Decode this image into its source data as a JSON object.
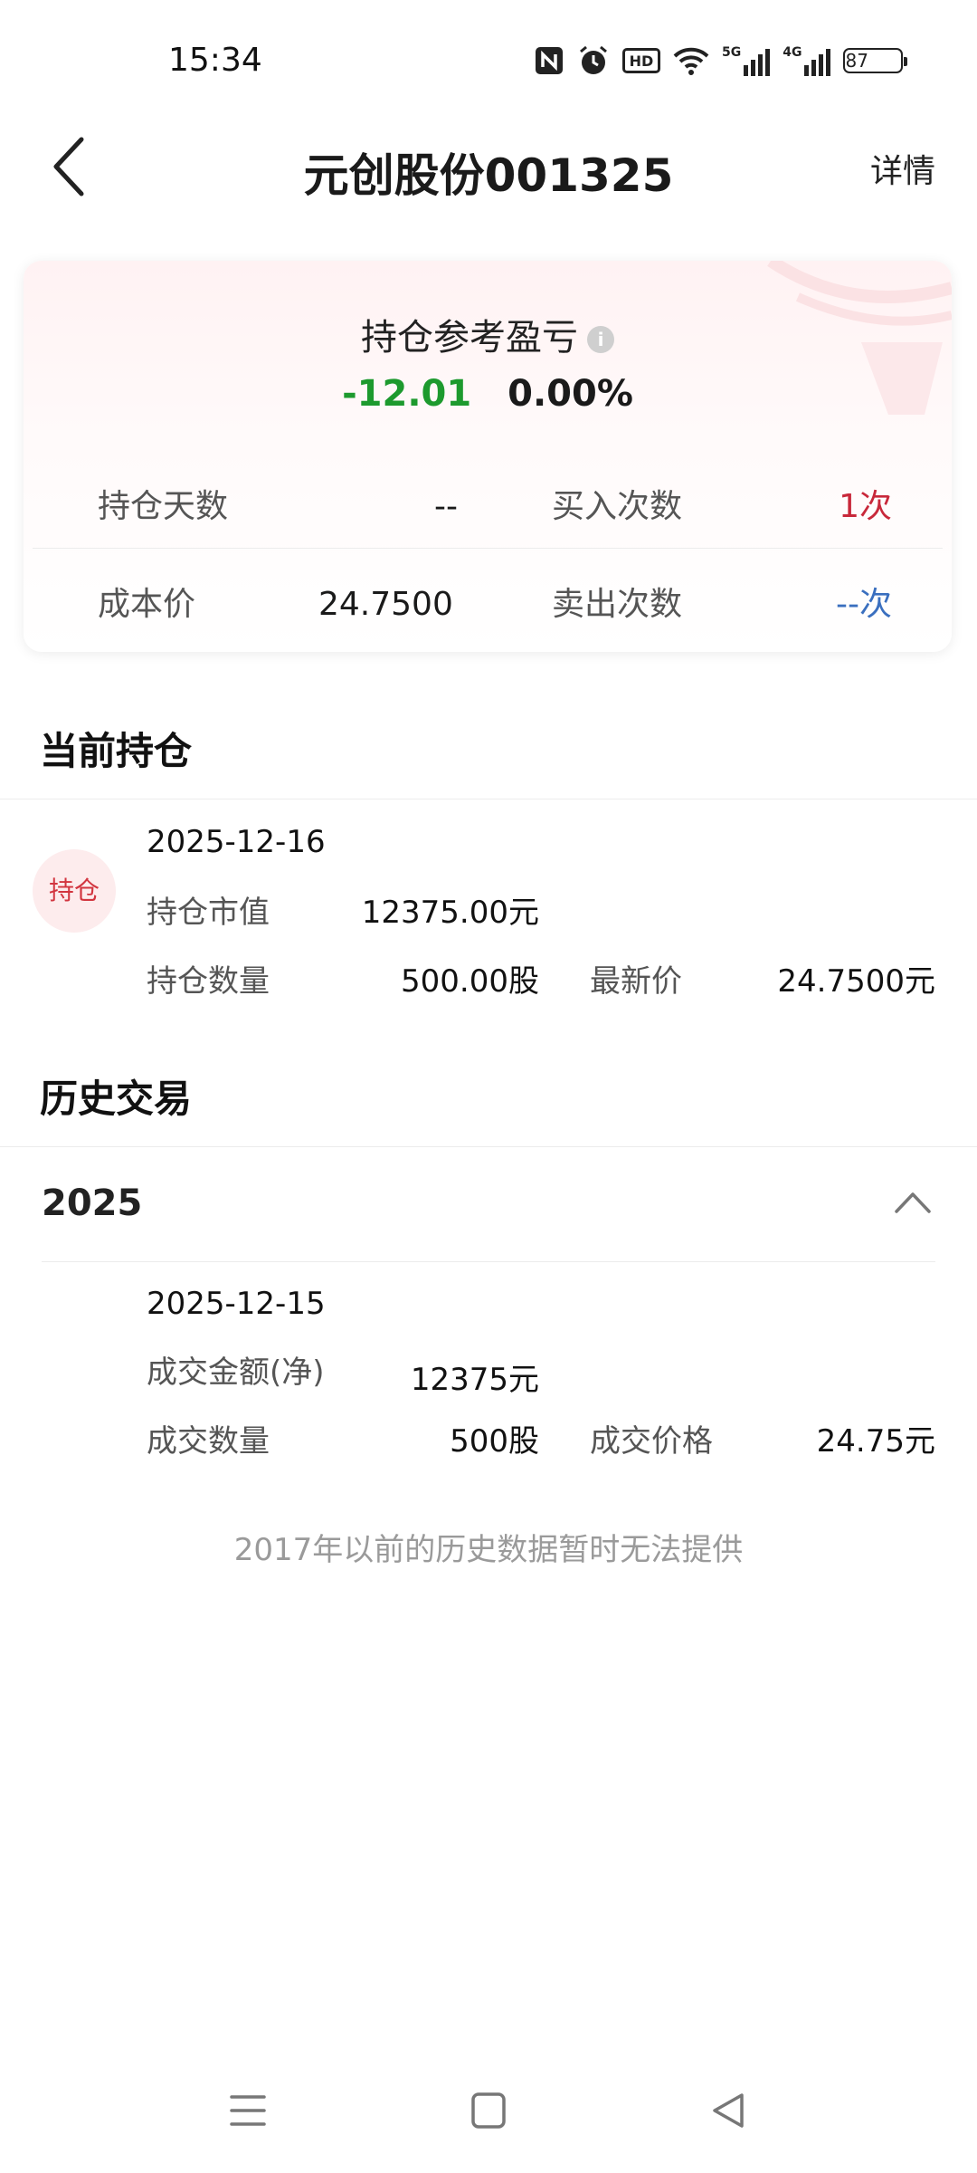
{
  "status_bar": {
    "time": "15:34",
    "battery": "87",
    "icons": [
      "nfc-icon",
      "alarm-icon",
      "hd-icon",
      "wifi-icon",
      "signal-5g-icon",
      "signal-4g-icon",
      "battery-icon"
    ],
    "hd_label": "HD",
    "net1": "5G",
    "net2": "4G"
  },
  "header": {
    "title": "元创股份001325",
    "detail_label": "详情"
  },
  "summary": {
    "pnl_label": "持仓参考盈亏",
    "info_glyph": "i",
    "pnl_amount": "-12.01",
    "pnl_percent": "0.00%",
    "pnl_color": "#1d9a2e",
    "rows": [
      {
        "left_label": "持仓天数",
        "left_value": "--",
        "right_label": "买入次数",
        "right_value": "1次",
        "right_color": "#c8283a"
      },
      {
        "left_label": "成本价",
        "left_value": "24.7500",
        "right_label": "卖出次数",
        "right_value": "--次",
        "right_color": "#3a6fbf"
      }
    ]
  },
  "current_holding": {
    "section_title": "当前持仓",
    "badge": "持仓",
    "date": "2025-12-16",
    "market_value_label": "持仓市值",
    "market_value": "12375.00元",
    "quantity_label": "持仓数量",
    "quantity": "500.00股",
    "latest_price_label": "最新价",
    "latest_price": "24.7500元"
  },
  "history": {
    "section_title": "历史交易",
    "year": "2025",
    "trade": {
      "date": "2025-12-15",
      "amount_label": "成交金额(净)",
      "amount": "12375元",
      "quantity_label": "成交数量",
      "quantity": "500股",
      "price_label": "成交价格",
      "price": "24.75元"
    },
    "footer_note": "2017年以前的历史数据暂时无法提供"
  },
  "nav_bar": {
    "icons": [
      "menu-icon",
      "home-icon",
      "back-triangle-icon"
    ]
  }
}
